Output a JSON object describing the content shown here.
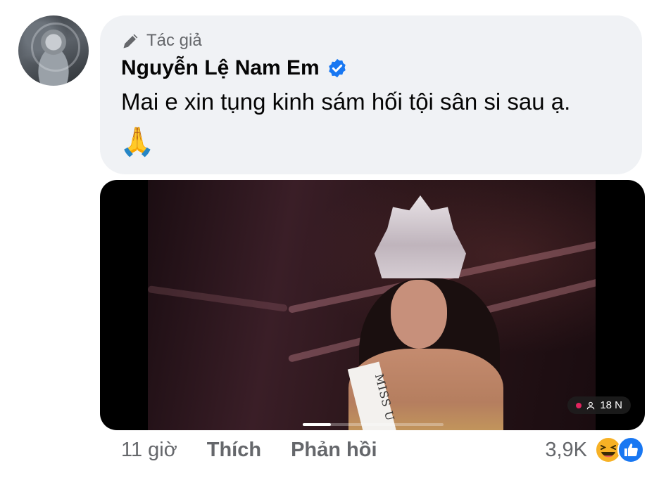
{
  "comment": {
    "author_badge": "Tác giả",
    "author_name": "Nguyễn Lệ Nam Em",
    "verified": true,
    "text": "Mai e xin tụng kinh sám hối tội sân si sau ạ.",
    "emoji": "🙏"
  },
  "video": {
    "live_viewers": "18 N",
    "sash_text": "MISS U",
    "progress": 0.2
  },
  "actions": {
    "time": "11 giờ",
    "like": "Thích",
    "reply": "Phản hồi"
  },
  "reactions": {
    "count": "3,9K",
    "icons": [
      "haha-icon",
      "like-icon"
    ]
  },
  "colors": {
    "bubble_bg": "#f0f2f5",
    "verified_blue": "#1877f2",
    "secondary_text": "#65676b"
  }
}
